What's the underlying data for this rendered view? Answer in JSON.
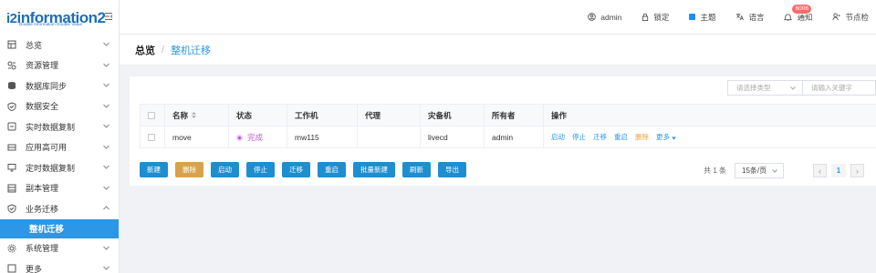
{
  "brand": {
    "logo_text": "information2",
    "logo_prefix": "i2",
    "tagline": "Double Information Double Value"
  },
  "sidebar": {
    "items": [
      {
        "label": "总览",
        "icon": "dashboard-icon"
      },
      {
        "label": "资源管理",
        "icon": "resource-icon"
      },
      {
        "label": "数据库同步",
        "icon": "database-icon"
      },
      {
        "label": "数据安全",
        "icon": "shield-icon"
      },
      {
        "label": "实时数据复制",
        "icon": "copy-icon"
      },
      {
        "label": "应用高可用",
        "icon": "server-icon"
      },
      {
        "label": "定时数据复制",
        "icon": "monitor-icon"
      },
      {
        "label": "副本管理",
        "icon": "replica-icon"
      },
      {
        "label": "业务迁移",
        "icon": "shield-check-icon"
      },
      {
        "label": "系统管理",
        "icon": "gear-icon"
      },
      {
        "label": "更多",
        "icon": "more-icon"
      }
    ],
    "active_sub": "整机迁移"
  },
  "header": {
    "user": "admin",
    "lock": "锁定",
    "theme": "主题",
    "language": "语言",
    "notice": "通知",
    "notice_count": "6006",
    "node": "节点检"
  },
  "breadcrumb": {
    "home": "总览",
    "separator": "/",
    "current": "整机迁移"
  },
  "filters": {
    "type_placeholder": "请选择类型",
    "keyword_placeholder": "请输入关键字"
  },
  "table": {
    "columns": [
      "名称",
      "状态",
      "工作机",
      "代理",
      "灾备机",
      "所有者",
      "操作"
    ],
    "rows": [
      {
        "name": "move",
        "status": "完成",
        "work": "mw115",
        "proxy": "",
        "backup": "livecd",
        "owner": "admin"
      }
    ],
    "row_actions": [
      "启动",
      "停止",
      "迁移",
      "重启",
      "删除",
      "更多"
    ]
  },
  "buttons": [
    "新建",
    "删除",
    "启动",
    "停止",
    "迁移",
    "重启",
    "批量新建",
    "刷新",
    "导出"
  ],
  "pager": {
    "total": "共 1 条",
    "page_size": "15条/页",
    "current_page": "1",
    "prev": "‹",
    "next": "›"
  },
  "colors": {
    "accent": "#2b97e6",
    "button": "#1e8ed0",
    "danger_button": "#d9a24a",
    "status_done": "#c05ad0",
    "badge": "#f56c6c"
  }
}
